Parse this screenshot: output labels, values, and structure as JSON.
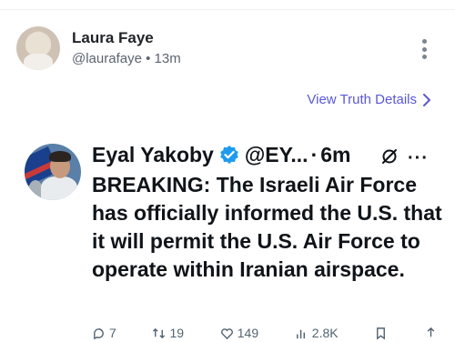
{
  "post": {
    "author_name": "Laura Faye",
    "author_handle": "@laurafaye",
    "separator": "•",
    "time_ago": "13m",
    "truth_details_link": "View Truth Details"
  },
  "tweet": {
    "name": "Eyal Yakoby",
    "handle": "@EY...",
    "separator": "·",
    "time_ago": "6m",
    "more": "···",
    "text": "BREAKING: The Israeli Air Force has officially informed the U.S. that it will permit the U.S. Air Force to operate within Iranian airspace.",
    "actions": {
      "replies": "7",
      "reposts": "19",
      "likes": "149",
      "views": "2.8K"
    }
  },
  "colors": {
    "link": "#5b58d6",
    "verified": "#1d9bf0",
    "muted": "#536471"
  },
  "icons": [
    "kebab-menu-icon",
    "chevron-right-icon",
    "verified-badge-icon",
    "grok-icon",
    "reply-icon",
    "repost-icon",
    "like-icon",
    "views-icon",
    "bookmark-icon",
    "share-icon"
  ]
}
